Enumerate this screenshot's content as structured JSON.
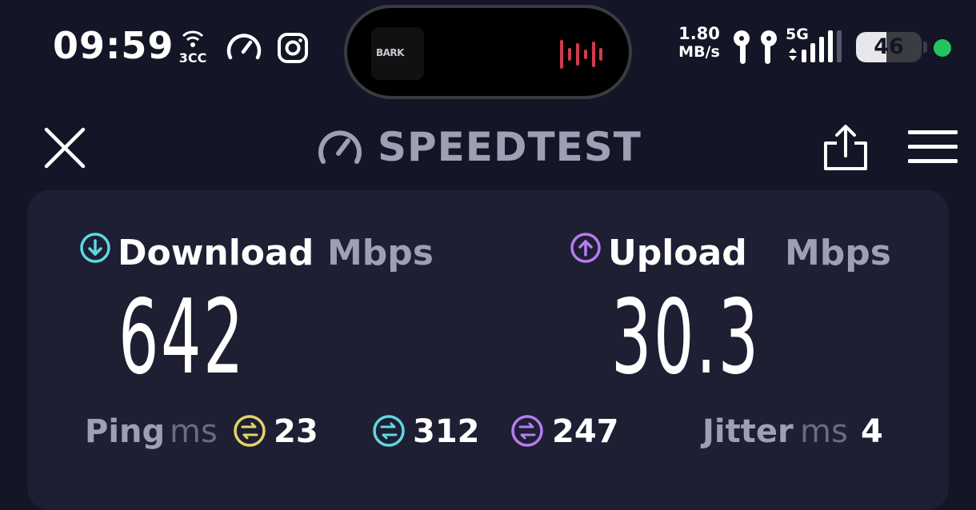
{
  "status_bar": {
    "time": "09:59",
    "carrier_badge": "3CC",
    "now_playing_art_text": "BARK",
    "net_speed_value": "1.80",
    "net_speed_unit": "MB/s",
    "network_type": "5G",
    "battery_level": "46",
    "battery_fraction": 0.46,
    "icons": [
      "hotspot-icon",
      "speedometer-icon",
      "instagram-icon",
      "audio-waveform-icon",
      "airpods-icon",
      "signal-bars-icon",
      "battery-icon",
      "privacy-indicator-dot"
    ],
    "dot_color": "#22c55e"
  },
  "header": {
    "title": "SPEEDTEST",
    "icons": [
      "close-icon",
      "speedtest-logo-icon",
      "share-icon",
      "hamburger-menu-icon"
    ]
  },
  "results": {
    "download": {
      "label": "Download",
      "unit": "Mbps",
      "value": "642",
      "color": "#5fd7e3",
      "icon": "download-arrow-icon"
    },
    "upload": {
      "label": "Upload",
      "unit": "Mbps",
      "value": "30.3",
      "color": "#b57cf0",
      "icon": "upload-arrow-icon"
    },
    "ping": {
      "label": "Ping",
      "unit": "ms",
      "idle": {
        "value": "23",
        "color": "#e6d36a",
        "icon": "ping-idle-icon"
      },
      "download": {
        "value": "312",
        "color": "#5fd7e3",
        "icon": "ping-download-icon"
      },
      "upload": {
        "value": "247",
        "color": "#b57cf0",
        "icon": "ping-upload-icon"
      }
    },
    "jitter": {
      "label": "Jitter",
      "unit": "ms",
      "value": "4"
    }
  },
  "colors": {
    "background": "#141526",
    "card": "#1e1f33",
    "muted_text": "#9e9fb3"
  }
}
